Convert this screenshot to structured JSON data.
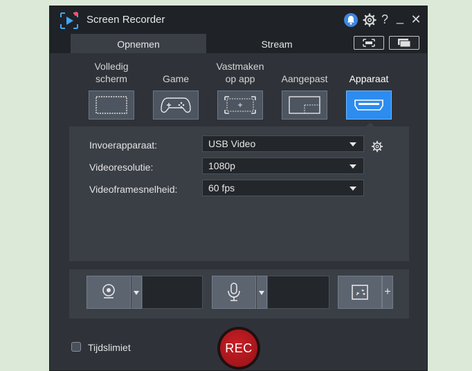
{
  "window": {
    "title": "Screen Recorder",
    "controls": {
      "help": "?",
      "minimize": "_",
      "close": "✕"
    }
  },
  "tabs": {
    "record": "Opnemen",
    "stream": "Stream"
  },
  "modes": [
    {
      "line1": "Volledig",
      "line2": "scherm",
      "icon": "fullscreen-icon",
      "selected": false
    },
    {
      "line1": "",
      "line2": "Game",
      "icon": "gamepad-icon",
      "selected": false
    },
    {
      "line1": "Vastmaken",
      "line2": "op app",
      "icon": "lock-to-app-icon",
      "selected": false
    },
    {
      "line1": "",
      "line2": "Aangepast",
      "icon": "custom-region-icon",
      "selected": false
    },
    {
      "line1": "",
      "line2": "Apparaat",
      "icon": "hdmi-device-icon",
      "selected": true
    }
  ],
  "settings": {
    "input_device": {
      "label": "Invoerapparaat:",
      "value": "USB Video"
    },
    "video_resolution": {
      "label": "Videoresolutie:",
      "value": "1080p"
    },
    "video_framerate": {
      "label": "Videoframesnelheid:",
      "value": "60 fps"
    }
  },
  "devices": {
    "plus": "+"
  },
  "footer": {
    "time_limit_label": "Tijdslimiet",
    "time_limit_checked": false,
    "rec_label": "REC"
  },
  "colors": {
    "accent": "#2d8cf0",
    "rec": "#b81a20",
    "notification": "#3e86e0"
  }
}
